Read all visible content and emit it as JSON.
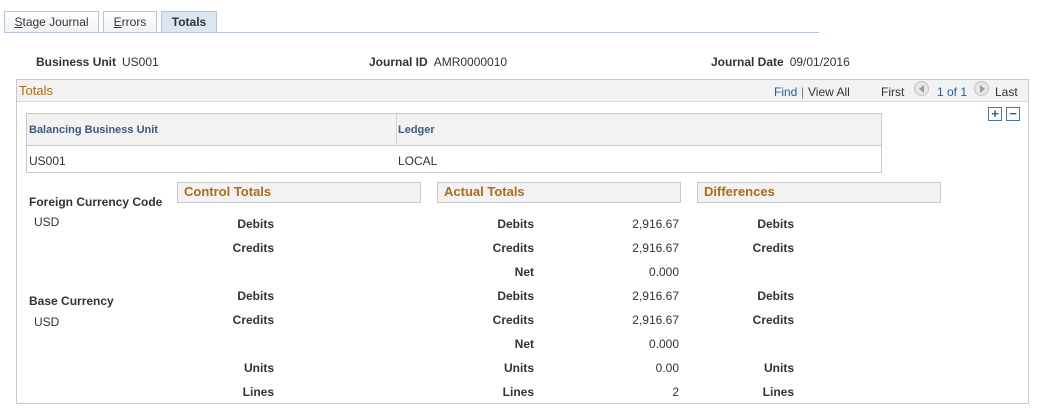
{
  "tabs": [
    {
      "label": "Stage Journal",
      "first": "S",
      "rest": "tage Journal"
    },
    {
      "label": "Errors",
      "first": "E",
      "rest": "rrors"
    },
    {
      "label": "Totals",
      "first": "",
      "rest": "Totals"
    }
  ],
  "header": {
    "business_unit_label": "Business Unit",
    "business_unit": "US001",
    "journal_id_label": "Journal ID",
    "journal_id": "AMR0000010",
    "journal_date_label": "Journal Date",
    "journal_date": "09/01/2016"
  },
  "totals": {
    "title": "Totals",
    "find": "Find",
    "sep": "|",
    "view_all": "View All",
    "first": "First",
    "paging": "1 of 1",
    "last": "Last",
    "add": "+",
    "remove": "−"
  },
  "grid": {
    "columns": [
      "Balancing Business Unit",
      "Ledger"
    ],
    "row": [
      "US001",
      "LOCAL"
    ]
  },
  "sections": {
    "control": "Control Totals",
    "actual": "Actual Totals",
    "differences": "Differences"
  },
  "foreign": {
    "label": "Foreign Currency Code",
    "code": "USD"
  },
  "base": {
    "label": "Base Currency",
    "code": "USD"
  },
  "labels": {
    "debits": "Debits",
    "credits": "Credits",
    "net": "Net",
    "units": "Units",
    "lines": "Lines"
  },
  "values": {
    "foreign_debits": "2,916.67",
    "foreign_credits": "2,916.67",
    "foreign_net": "0.000",
    "base_debits": "2,916.67",
    "base_credits": "2,916.67",
    "base_net": "0.000",
    "units": "0.00",
    "lines": "2"
  },
  "colors": {
    "section_title": "#b16a1a",
    "link": "#1f5fa6"
  }
}
